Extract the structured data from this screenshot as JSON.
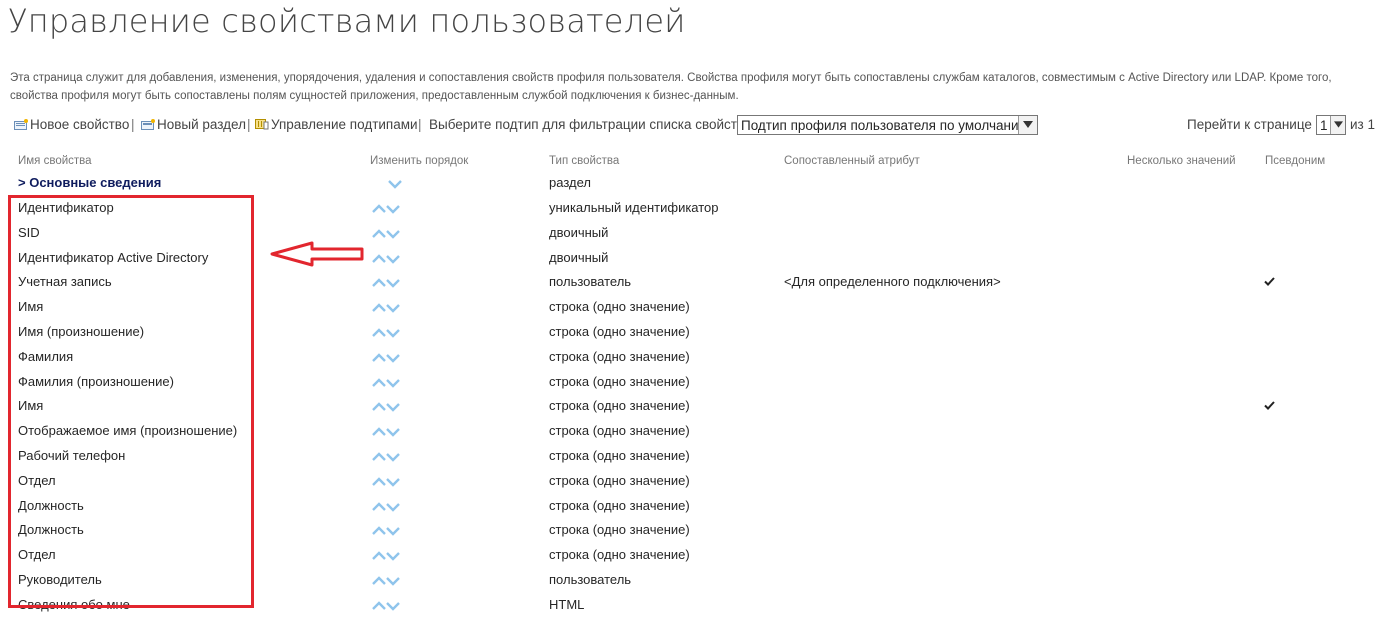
{
  "page": {
    "title": "Управление свойствами пользователей",
    "description": "Эта страница служит для добавления, изменения, упорядочения, удаления и сопоставления свойств профиля пользователя. Свойства профиля могут быть сопоставлены службам каталогов, совместимым с Active Directory или LDAP. Кроме того, свойства профиля могут быть сопоставлены полям сущностей приложения, предоставленным службой подключения к бизнес-данным."
  },
  "toolbar": {
    "new_property": "Новое свойство",
    "new_section": "Новый раздел",
    "manage_subtypes": "Управление подтипами",
    "separator": "|",
    "filter_label": "Выберите подтип для фильтрации списка свойств:",
    "filter_value": "Подтип профиля пользователя по умолчанию",
    "goto_label": "Перейти к странице",
    "page_value": "1",
    "page_of": "из 1"
  },
  "icons": {
    "new_property": "new-item-icon",
    "new_section": "new-section-icon",
    "manage_subtypes": "subtype-manage-icon",
    "move_up": "arrow-up-icon",
    "move_down": "arrow-down-icon",
    "alias": "checkmark-icon"
  },
  "columns": {
    "name": "Имя свойства",
    "order": "Изменить порядок",
    "type": "Тип свойства",
    "mapped": "Сопоставленный атрибут",
    "multi": "Несколько значений",
    "alias": "Псевдоним"
  },
  "section": {
    "label": "> Основные сведения",
    "type": "раздел"
  },
  "rows": [
    {
      "name": "Идентификатор",
      "type": "уникальный идентификатор",
      "mapped": "",
      "alias": false
    },
    {
      "name": "SID",
      "type": "двоичный",
      "mapped": "",
      "alias": false
    },
    {
      "name": "Идентификатор Active Directory",
      "type": "двоичный",
      "mapped": "",
      "alias": false
    },
    {
      "name": "Учетная запись",
      "type": "пользователь",
      "mapped": "<Для определенного подключения>",
      "alias": true
    },
    {
      "name": "Имя",
      "type": "строка (одно значение)",
      "mapped": "",
      "alias": false
    },
    {
      "name": "Имя (произношение)",
      "type": "строка (одно значение)",
      "mapped": "",
      "alias": false
    },
    {
      "name": "Фамилия",
      "type": "строка (одно значение)",
      "mapped": "",
      "alias": false
    },
    {
      "name": "Фамилия (произношение)",
      "type": "строка (одно значение)",
      "mapped": "",
      "alias": false
    },
    {
      "name": "Имя",
      "type": "строка (одно значение)",
      "mapped": "",
      "alias": true
    },
    {
      "name": "Отображаемое имя (произношение)",
      "type": "строка (одно значение)",
      "mapped": "",
      "alias": false
    },
    {
      "name": "Рабочий телефон",
      "type": "строка (одно значение)",
      "mapped": "",
      "alias": false
    },
    {
      "name": "Отдел",
      "type": "строка (одно значение)",
      "mapped": "",
      "alias": false
    },
    {
      "name": "Должность",
      "type": "строка (одно значение)",
      "mapped": "",
      "alias": false
    },
    {
      "name": "Должность",
      "type": "строка (одно значение)",
      "mapped": "",
      "alias": false
    },
    {
      "name": "Отдел",
      "type": "строка (одно значение)",
      "mapped": "",
      "alias": false
    },
    {
      "name": "Руководитель",
      "type": "пользователь",
      "mapped": "",
      "alias": false
    },
    {
      "name": "Сведения обо мне",
      "type": "HTML",
      "mapped": "",
      "alias": false
    }
  ],
  "colors": {
    "title": "#444444",
    "section": "#0f1c5e",
    "arrow": "#8fc4ec",
    "highlight": "#e2262e"
  }
}
